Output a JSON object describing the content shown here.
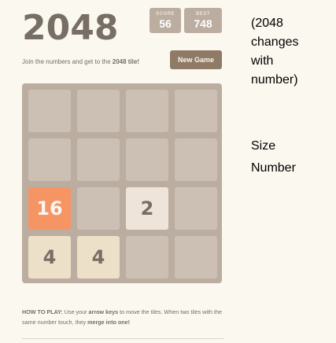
{
  "game": {
    "title": "2048",
    "score": {
      "label": "SCORE",
      "value": "56"
    },
    "best": {
      "label": "BEST",
      "value": "748"
    },
    "intro": {
      "before": "Join the numbers and get to the ",
      "bold": "2048 tile!"
    },
    "new_game_label": "New Game"
  },
  "board": {
    "rows": [
      [
        null,
        null,
        null,
        null
      ],
      [
        null,
        null,
        null,
        null
      ],
      [
        "16",
        null,
        "2",
        null
      ],
      [
        "4",
        "4",
        null,
        null
      ]
    ]
  },
  "how_to_play": {
    "label": "HOW TO PLAY:",
    "part1": " Use your ",
    "bold1": "arrow keys",
    "part2": " to move the tiles. When two tiles with the same number touch, they ",
    "bold2": "merge into one!"
  },
  "annotations": {
    "top_lines": [
      "(2048",
      "changes",
      "with",
      "number)"
    ],
    "size": "Size",
    "number": "Number"
  }
}
